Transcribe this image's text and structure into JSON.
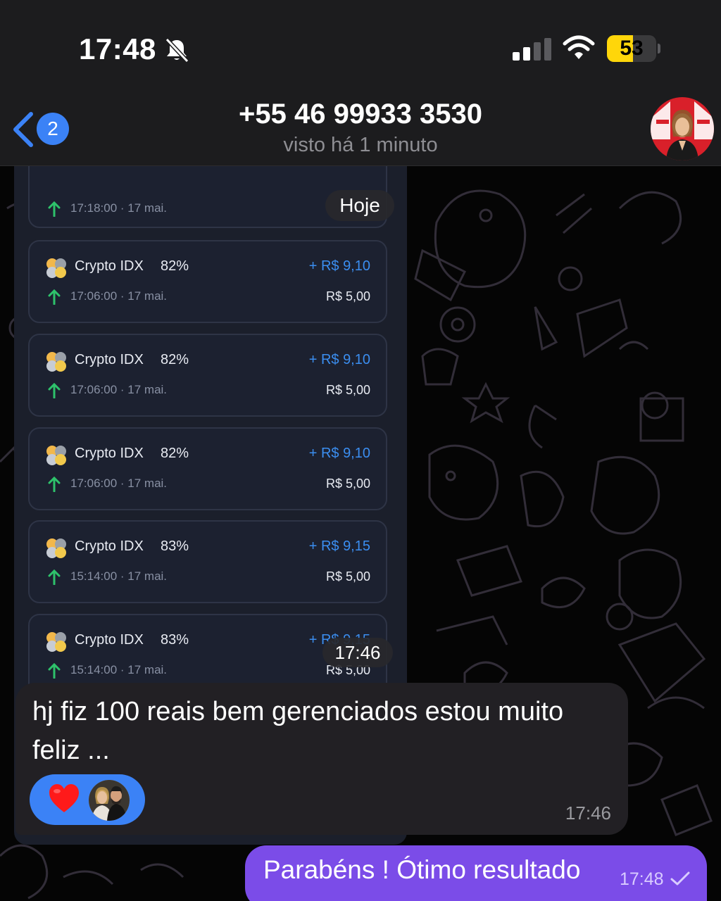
{
  "status_bar": {
    "time": "17:48",
    "battery": "53",
    "battery_level": 0.53,
    "icons": [
      "bell-slash-icon",
      "signal-icon",
      "wifi-icon",
      "battery-icon"
    ]
  },
  "header": {
    "back_badge": "2",
    "title": "+55 46 99933 3530",
    "subtitle": "visto há 1 minuto"
  },
  "screenshot": {
    "partial_card": {
      "time": "17:18:00 · 17 mai."
    },
    "cards": [
      {
        "asset": "Crypto IDX",
        "pct": "82%",
        "profit": "+ R$ 9,10",
        "time": "17:06:00 · 17 mai.",
        "amount": "R$ 5,00"
      },
      {
        "asset": "Crypto IDX",
        "pct": "82%",
        "profit": "+ R$ 9,10",
        "time": "17:06:00 · 17 mai.",
        "amount": "R$ 5,00"
      },
      {
        "asset": "Crypto IDX",
        "pct": "82%",
        "profit": "+ R$ 9,10",
        "time": "17:06:00 · 17 mai.",
        "amount": "R$ 5,00"
      },
      {
        "asset": "Crypto IDX",
        "pct": "83%",
        "profit": "+ R$ 9,15",
        "time": "15:14:00 · 17 mai.",
        "amount": "R$ 5,00"
      },
      {
        "asset": "Crypto IDX",
        "pct": "83%",
        "profit": "+ R$ 9,15",
        "time": "15:14:00 · 17 mai.",
        "amount": "R$ 5,00"
      }
    ]
  },
  "date_pill": "Hoje",
  "photo_time": "17:46",
  "incoming": {
    "text": "hj fiz 100 reais bem gerenciados estou muito feliz ...",
    "time": "17:46",
    "reaction_emoji": "heart-icon"
  },
  "outgoing": {
    "text": "Parabéns ! Ótimo resultado",
    "time": "17:48"
  },
  "colors": {
    "accent_blue": "#3b82f6",
    "outgoing_purple": "#7b4ce8",
    "profit_blue": "#3b8ef0",
    "battery_yellow": "#ffd60a"
  }
}
